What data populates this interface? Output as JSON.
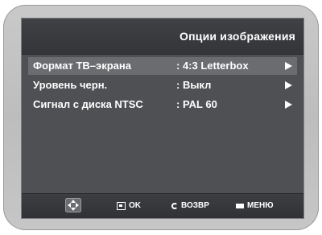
{
  "header": {
    "title": "Опции изображения"
  },
  "menu": {
    "items": [
      {
        "label": "Формат ТВ–экрана",
        "value": ": 4:3 Letterbox",
        "selected": true
      },
      {
        "label": "Уровень черн.",
        "value": ": Выкл",
        "selected": false
      },
      {
        "label": "Сигнал с диска NTSC",
        "value": ": PAL 60",
        "selected": false
      }
    ]
  },
  "footer": {
    "ok_label": "OK",
    "return_label": "ВОЗВР",
    "menu_label": "МЕНЮ"
  },
  "icons": {
    "navigate": "dpad-icon",
    "ok": "enter-icon",
    "return": "return-icon",
    "menu": "menu-icon"
  }
}
